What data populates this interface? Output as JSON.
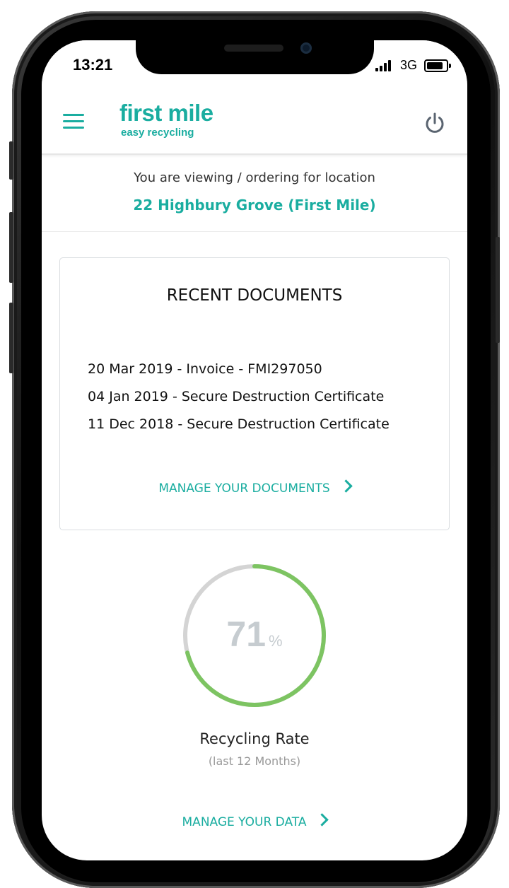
{
  "status_bar": {
    "time": "13:21",
    "network": "3G"
  },
  "header": {
    "logo_main": "first mile",
    "logo_sub": "easy recycling",
    "brand_color": "#1aada0"
  },
  "location": {
    "label": "You are viewing / ordering for location",
    "name": "22 Highbury Grove (First Mile)"
  },
  "documents": {
    "title": "RECENT DOCUMENTS",
    "items": [
      "20 Mar 2019 - Invoice - FMI297050",
      "04 Jan 2019 - Secure Destruction Certificate",
      "11 Dec 2018 - Secure Destruction Certificate"
    ],
    "link_label": "MANAGE YOUR DOCUMENTS"
  },
  "recycling": {
    "value": "71",
    "unit": "%",
    "progress": 0.71,
    "progress_color": "#7dc462",
    "track_color": "#d4d4d4",
    "label": "Recycling Rate",
    "sublabel": "(last 12 Months)",
    "link_label": "MANAGE YOUR DATA"
  },
  "icons": {
    "menu": "hamburger-menu-icon",
    "power": "power-icon",
    "chevron": "chevron-right-icon"
  }
}
